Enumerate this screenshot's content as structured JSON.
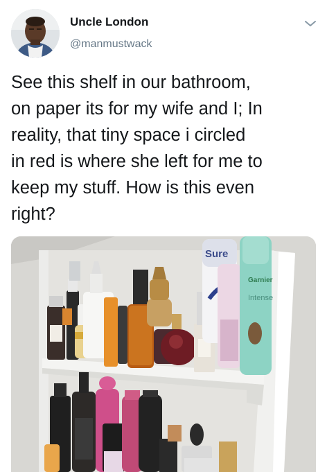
{
  "tweet": {
    "author": {
      "display_name": "Uncle London",
      "handle": "@manmustwack",
      "avatar_icon": "user-avatar"
    },
    "menu_icon": "chevron-down-icon",
    "text_lines": [
      "See this shelf in our bathroom,",
      "on paper its for my wife and I; In",
      "reality, that tiny space i circled",
      "in red is where she left for me to",
      "keep my stuff. How is this even",
      "right?"
    ],
    "media": {
      "description_icon": "bathroom-shelf-photo",
      "product_labels": {
        "deodorant_brand": "Sure",
        "bottle_brand": "Garnier",
        "bottle_subbrand": "Intense"
      }
    }
  },
  "colors": {
    "text": "#14171a",
    "secondary": "#657786"
  }
}
